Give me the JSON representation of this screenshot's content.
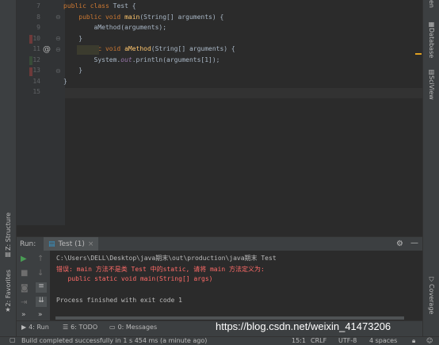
{
  "editor": {
    "lines": [
      {
        "no": "7",
        "parts": [
          [
            "kw",
            "public class "
          ],
          [
            "txt",
            "Test {"
          ]
        ]
      },
      {
        "no": "8",
        "parts": [
          [
            "txt",
            "    "
          ],
          [
            "kw",
            "public void "
          ],
          [
            "fn",
            "main"
          ],
          [
            "txt",
            "(String[] arguments) {"
          ]
        ]
      },
      {
        "no": "9",
        "parts": [
          [
            "txt",
            "        aMethod(arguments);"
          ]
        ]
      },
      {
        "no": "10",
        "parts": [
          [
            "txt",
            "    }"
          ]
        ]
      },
      {
        "no": "11",
        "parts": [
          [
            "txt",
            "    "
          ],
          [
            "kw",
            "public void "
          ],
          [
            "fn",
            "aMethod"
          ],
          [
            "txt",
            "(String[] arguments) {"
          ]
        ]
      },
      {
        "no": "12",
        "parts": [
          [
            "txt",
            "        System."
          ],
          [
            "fld",
            "out"
          ],
          [
            "txt",
            ".println(arguments[1]);"
          ]
        ]
      },
      {
        "no": "13",
        "parts": [
          [
            "txt",
            "    }"
          ]
        ]
      },
      {
        "no": "14",
        "parts": [
          [
            "txt",
            "}"
          ]
        ]
      },
      {
        "no": "15",
        "parts": []
      }
    ]
  },
  "left_strip": {
    "structure_label": "Z: Structure",
    "favorites_label": "2: Favorites"
  },
  "right_strip": {
    "database_label": "Database",
    "sciview_label": "SciView",
    "coverage_label": "Coverage"
  },
  "run_panel": {
    "title": "Run:",
    "tab_label": "Test (1)",
    "console": [
      {
        "text": "C:\\Users\\DELL\\Desktop\\java期末\\out\\production\\java期末 Test",
        "color": "#bbbbbb"
      },
      {
        "text": "错误: main 方法不是类 Test 中的static, 请将 main 方法定义为:",
        "color": "#ff6b68"
      },
      {
        "text": "   public static void main(String[] args)",
        "color": "#ff6b68"
      },
      {
        "text": "",
        "color": "#bbbbbb"
      },
      {
        "text": "Process finished with exit code 1",
        "color": "#bbbbbb"
      }
    ]
  },
  "bottom_bar": {
    "run_label": "4: Run",
    "todo_label": "6: TODO",
    "messages_label": "0: Messages"
  },
  "status_bar": {
    "message": "Build completed successfully in 1 s 454 ms (a minute ago)",
    "position": "15:1",
    "line_sep": "CRLF",
    "encoding": "UTF-8",
    "indent": "4 spaces"
  },
  "watermark": "https://blog.csdn.net/weixin_41473206",
  "colors": {
    "accent_run": "#499c54",
    "error_text": "#ff6b68"
  }
}
